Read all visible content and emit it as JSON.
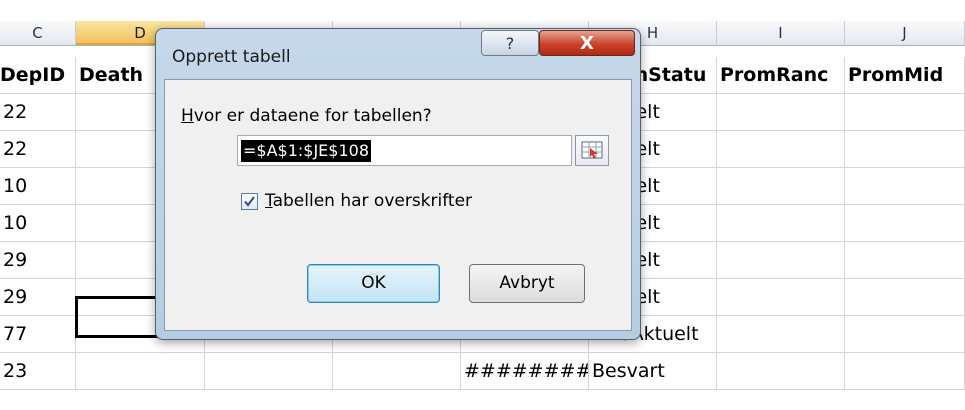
{
  "columns": [
    {
      "letter": "C",
      "selected": false
    },
    {
      "letter": "D",
      "selected": true
    },
    {
      "letter": "",
      "selected": false
    },
    {
      "letter": "",
      "selected": false
    },
    {
      "letter": "",
      "selected": false
    },
    {
      "letter": "H",
      "selected": false
    },
    {
      "letter": "I",
      "selected": false
    },
    {
      "letter": "J",
      "selected": false
    }
  ],
  "header_row": {
    "c": "DepID",
    "d": "Death",
    "h": "PromStatu",
    "i": "PromRanc",
    "j": "PromMid"
  },
  "rows": [
    {
      "c": "22",
      "g": "",
      "h": "Aktuelt"
    },
    {
      "c": "22",
      "g": "",
      "h": "Aktuelt"
    },
    {
      "c": "10",
      "g": "",
      "h": "Aktuelt"
    },
    {
      "c": "10",
      "g": "",
      "h": "Aktuelt"
    },
    {
      "c": "29",
      "g": "",
      "h": "Aktuelt"
    },
    {
      "c": "29",
      "g": "",
      "h": "Aktuelt"
    },
    {
      "c": "77",
      "g": "########",
      "h": "IkkeAktuelt"
    },
    {
      "c": "23",
      "g": "########",
      "h": "Besvart"
    }
  ],
  "dialog": {
    "title": "Opprett tabell",
    "help_label": "?",
    "close_label": "X",
    "question_accel": "H",
    "question_rest": "vor er dataene for tabellen?",
    "range_value": "=$A$1:$JE$108",
    "checkbox_checked": true,
    "checkbox_accel": "T",
    "checkbox_rest": "abellen har overskrifter",
    "ok_label": "OK",
    "cancel_label": "Avbryt"
  }
}
